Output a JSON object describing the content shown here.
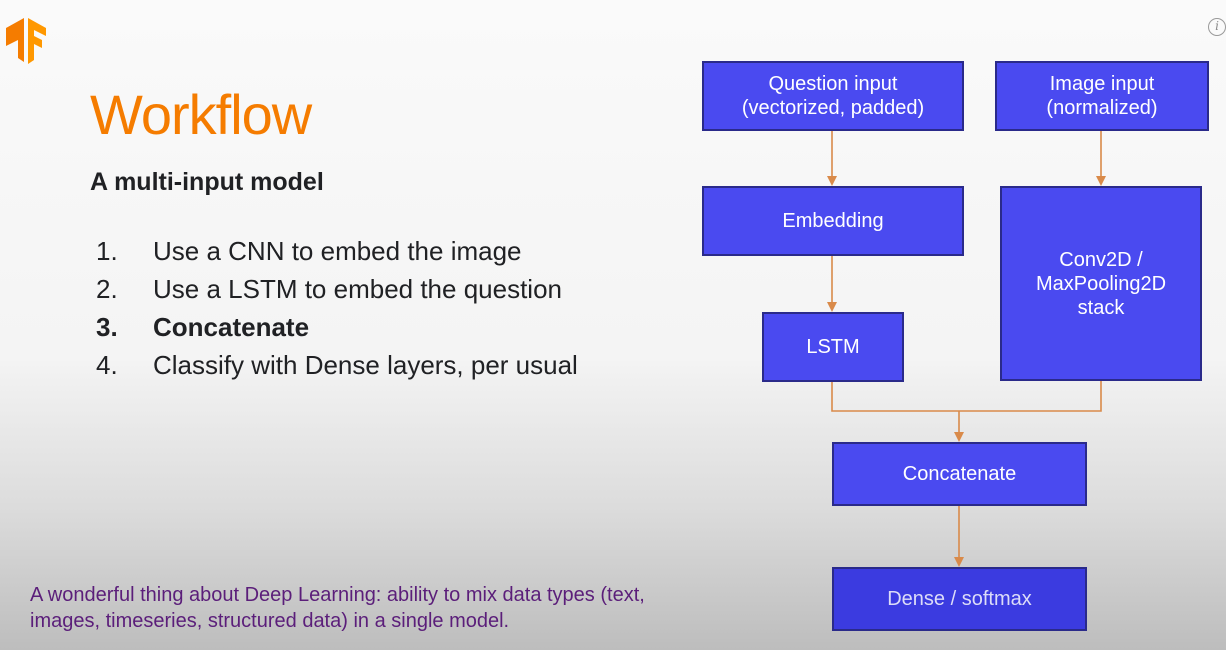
{
  "slide": {
    "title": "Workflow",
    "subtitle": "A multi-input model",
    "steps": [
      {
        "num": "1.",
        "text": "Use a CNN to embed the image"
      },
      {
        "num": "2.",
        "text": "Use a LSTM to embed the question"
      },
      {
        "num": "3.",
        "text": "Concatenate",
        "bold": true
      },
      {
        "num": "4.",
        "text": "Classify with Dense layers, per usual"
      }
    ],
    "caption": "A wonderful thing about Deep Learning: ability to mix data types (text, images, timeseries, structured data) in a single model."
  },
  "diagram": {
    "question_input": "Question input\n(vectorized, padded)",
    "image_input": "Image input\n(normalized)",
    "embedding": "Embedding",
    "lstm": "LSTM",
    "conv_stack": "Conv2D /\nMaxPooling2D\nstack",
    "concatenate": "Concatenate",
    "dense": "Dense / softmax"
  },
  "colors": {
    "accent": "#f57c00",
    "box_fill": "#4a4af0",
    "box_border": "#2a2a8a",
    "connector": "#d98a4a",
    "caption": "#5b1e7a"
  },
  "icons": [
    "tensorflow-logo",
    "info-icon"
  ]
}
